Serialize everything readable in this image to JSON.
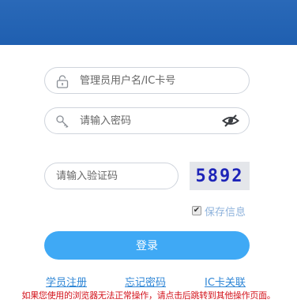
{
  "form": {
    "username_placeholder": "管理员用户名/IC卡号",
    "password_placeholder": "请输入密码",
    "captcha_placeholder": "请输入验证码",
    "captcha_code": "5892",
    "remember_label": "保存信息",
    "remember_checked": true,
    "login_label": "登录"
  },
  "links": {
    "register": "学员注册",
    "forgot_password": "忘记密码",
    "ic_card_link": "IC卡关联"
  },
  "notice": "如果您使用的浏览器无法正常操作，请点击后跳转到其他操作页面。",
  "icons": {
    "username": "lock-icon",
    "password": "key-icon",
    "toggle_password": "eye-slash-icon"
  },
  "colors": {
    "header": "#2265b5",
    "login_button": "#3fa9f5",
    "link": "#2f86d6",
    "notice": "#d3141d",
    "captcha_text": "#1d24b8"
  }
}
